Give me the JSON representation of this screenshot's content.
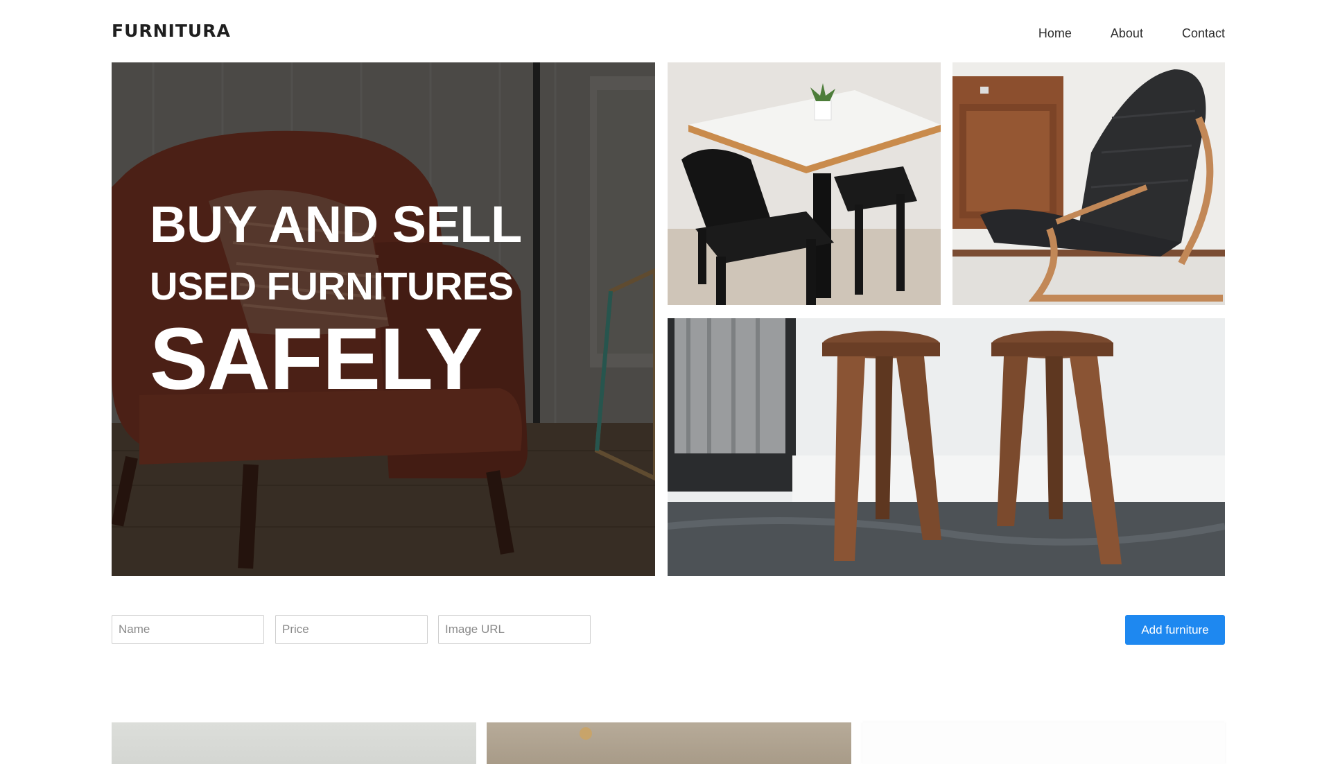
{
  "brand": {
    "logo": "FURNITURA"
  },
  "nav": {
    "items": [
      "Home",
      "About",
      "Contact"
    ]
  },
  "hero": {
    "line1": "BUY AND SELL",
    "line2": "USED FURNITURES",
    "line3": "SAFELY"
  },
  "form": {
    "name_placeholder": "Name",
    "price_placeholder": "Price",
    "url_placeholder": "Image URL",
    "submit_label": "Add furniture"
  },
  "colors": {
    "accent": "#1e88f0",
    "chair_red": "#7a3524",
    "wood": "#8a4b2a"
  }
}
